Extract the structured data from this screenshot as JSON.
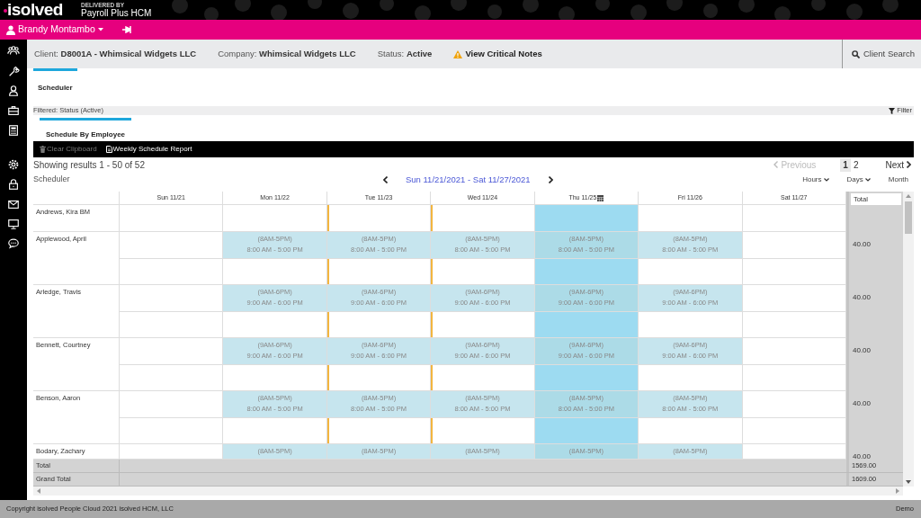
{
  "brand": {
    "logo": "isolved",
    "delivered_by": "DELIVERED BY",
    "partner": "Payroll Plus HCM"
  },
  "user": {
    "name": "Brandy Montambo"
  },
  "client_bar": {
    "client": "Client: **D8001A - Whimsical Widgets LLC**",
    "company": "Company: **Whimsical Widgets LLC**",
    "status": "Status: **Active**",
    "notes_link": "View Critical Notes",
    "search": "Client Search"
  },
  "tabs": [
    {
      "label": "Scheduler",
      "selected": true
    }
  ],
  "filter_bar": {
    "text": "Filtered: Status (Active)",
    "filter_button": "Filter"
  },
  "subtabs": [
    {
      "label": "Schedule By Employee",
      "selected": true
    }
  ],
  "toolbar": [
    {
      "kind": "trash",
      "label": "Clear Clipboard",
      "disabled": true
    },
    {
      "kind": "report",
      "label": "Weekly Schedule Report",
      "disabled": false
    }
  ],
  "results": "Showing results 1 - 50 of 52",
  "pagination": {
    "previous": "Previous",
    "previous_disabled": true,
    "pages": [
      {
        "label": "1",
        "selected": true
      },
      {
        "label": "2",
        "selected": false
      }
    ],
    "next": "Next"
  },
  "scheduler": {
    "title": "Scheduler",
    "range": "Sun 11/21/2021 - Sat 11/27/2021",
    "views": [
      {
        "label": "Hours",
        "dropdown": true
      },
      {
        "label": "Days",
        "dropdown": true
      },
      {
        "label": "Month",
        "dropdown": false
      }
    ],
    "days": [
      {
        "label": "Sun 11/21",
        "today": false,
        "flagged": false
      },
      {
        "label": "Mon 11/22",
        "today": false,
        "flagged": false
      },
      {
        "label": "Tue 11/23",
        "today": false,
        "flagged": true
      },
      {
        "label": "Wed 11/24",
        "today": false,
        "flagged": true
      },
      {
        "label": "Thu 11/25",
        "today": true,
        "flagged": false
      },
      {
        "label": "Fri 11/26",
        "today": false,
        "flagged": false
      },
      {
        "label": "Sat 11/27",
        "today": false,
        "flagged": false
      }
    ],
    "total_header": "Total",
    "employees": [
      {
        "name": "Andrews, Kira BM",
        "rows": [
          [
            {
              "kind": "off"
            },
            {
              "kind": "off"
            },
            {
              "kind": "off"
            },
            {
              "kind": "off"
            },
            {
              "kind": "off"
            },
            {
              "kind": "off"
            },
            {
              "kind": "off"
            }
          ]
        ]
      },
      {
        "name": "Applewood, April",
        "total": "40.00",
        "rows": [
          [
            {
              "kind": "off"
            },
            {
              "kind": "shift",
              "label": "(8AM-5PM)",
              "time": "8:00 AM - 5:00 PM"
            },
            {
              "kind": "shift",
              "label": "(8AM-5PM)",
              "time": "8:00 AM - 5:00 PM"
            },
            {
              "kind": "shift",
              "label": "(8AM-5PM)",
              "time": "8:00 AM - 5:00 PM"
            },
            {
              "kind": "shift",
              "label": "(8AM-5PM)",
              "time": "8:00 AM - 5:00 PM"
            },
            {
              "kind": "shift",
              "label": "(8AM-5PM)",
              "time": "8:00 AM - 5:00 PM"
            },
            {
              "kind": "off"
            }
          ],
          [
            {
              "kind": "off"
            },
            {
              "kind": "off"
            },
            {
              "kind": "off"
            },
            {
              "kind": "off"
            },
            {
              "kind": "off"
            },
            {
              "kind": "off"
            },
            {
              "kind": "off"
            }
          ]
        ]
      },
      {
        "name": "Arledge, Travis",
        "total": "40.00",
        "rows": [
          [
            {
              "kind": "off"
            },
            {
              "kind": "shift",
              "label": "(9AM-6PM)",
              "time": "9:00 AM - 6:00 PM"
            },
            {
              "kind": "shift",
              "label": "(9AM-6PM)",
              "time": "9:00 AM - 6:00 PM"
            },
            {
              "kind": "shift",
              "label": "(9AM-6PM)",
              "time": "9:00 AM - 6:00 PM"
            },
            {
              "kind": "shift",
              "label": "(9AM-6PM)",
              "time": "9:00 AM - 6:00 PM"
            },
            {
              "kind": "shift",
              "label": "(9AM-6PM)",
              "time": "9:00 AM - 6:00 PM"
            },
            {
              "kind": "off"
            }
          ],
          [
            {
              "kind": "off"
            },
            {
              "kind": "off"
            },
            {
              "kind": "off"
            },
            {
              "kind": "off"
            },
            {
              "kind": "off"
            },
            {
              "kind": "off"
            },
            {
              "kind": "off"
            }
          ]
        ]
      },
      {
        "name": "Bennett, Courtney",
        "total": "40.00",
        "rows": [
          [
            {
              "kind": "off"
            },
            {
              "kind": "shift",
              "label": "(9AM-6PM)",
              "time": "9:00 AM - 6:00 PM"
            },
            {
              "kind": "shift",
              "label": "(9AM-6PM)",
              "time": "9:00 AM - 6:00 PM"
            },
            {
              "kind": "shift",
              "label": "(9AM-6PM)",
              "time": "9:00 AM - 6:00 PM"
            },
            {
              "kind": "shift",
              "label": "(9AM-6PM)",
              "time": "9:00 AM - 6:00 PM"
            },
            {
              "kind": "shift",
              "label": "(9AM-6PM)",
              "time": "9:00 AM - 6:00 PM"
            },
            {
              "kind": "off"
            }
          ],
          [
            {
              "kind": "off"
            },
            {
              "kind": "off"
            },
            {
              "kind": "off"
            },
            {
              "kind": "off"
            },
            {
              "kind": "off"
            },
            {
              "kind": "off"
            },
            {
              "kind": "off"
            }
          ]
        ]
      },
      {
        "name": "Benson, Aaron",
        "total": "40.00",
        "rows": [
          [
            {
              "kind": "off"
            },
            {
              "kind": "shift",
              "label": "(8AM-5PM)",
              "time": "8:00 AM - 5:00 PM"
            },
            {
              "kind": "shift",
              "label": "(8AM-5PM)",
              "time": "8:00 AM - 5:00 PM"
            },
            {
              "kind": "shift",
              "label": "(8AM-5PM)",
              "time": "8:00 AM - 5:00 PM"
            },
            {
              "kind": "shift",
              "label": "(8AM-5PM)",
              "time": "8:00 AM - 5:00 PM"
            },
            {
              "kind": "shift",
              "label": "(8AM-5PM)",
              "time": "8:00 AM - 5:00 PM"
            },
            {
              "kind": "off"
            }
          ],
          [
            {
              "kind": "off"
            },
            {
              "kind": "off"
            },
            {
              "kind": "off"
            },
            {
              "kind": "off"
            },
            {
              "kind": "off"
            },
            {
              "kind": "off"
            },
            {
              "kind": "off"
            }
          ]
        ]
      },
      {
        "name": "Bodary, Zachary",
        "total": "40.00",
        "rows": [
          [
            {
              "kind": "off"
            },
            {
              "kind": "shift",
              "label": "(8AM-5PM)"
            },
            {
              "kind": "shift",
              "label": "(8AM-5PM)"
            },
            {
              "kind": "shift",
              "label": "(8AM-5PM)"
            },
            {
              "kind": "shift",
              "label": "(8AM-5PM)"
            },
            {
              "kind": "shift",
              "label": "(8AM-5PM)"
            },
            {
              "kind": "off"
            }
          ]
        ]
      }
    ],
    "totals": [
      {
        "label": "Total",
        "value": "1569.00"
      },
      {
        "label": "Grand Total",
        "value": "1609.00"
      }
    ]
  },
  "footer": {
    "copyright": "Copyright isolved People Cloud 2021 isolved HCM, LLC",
    "environment": "Demo"
  }
}
